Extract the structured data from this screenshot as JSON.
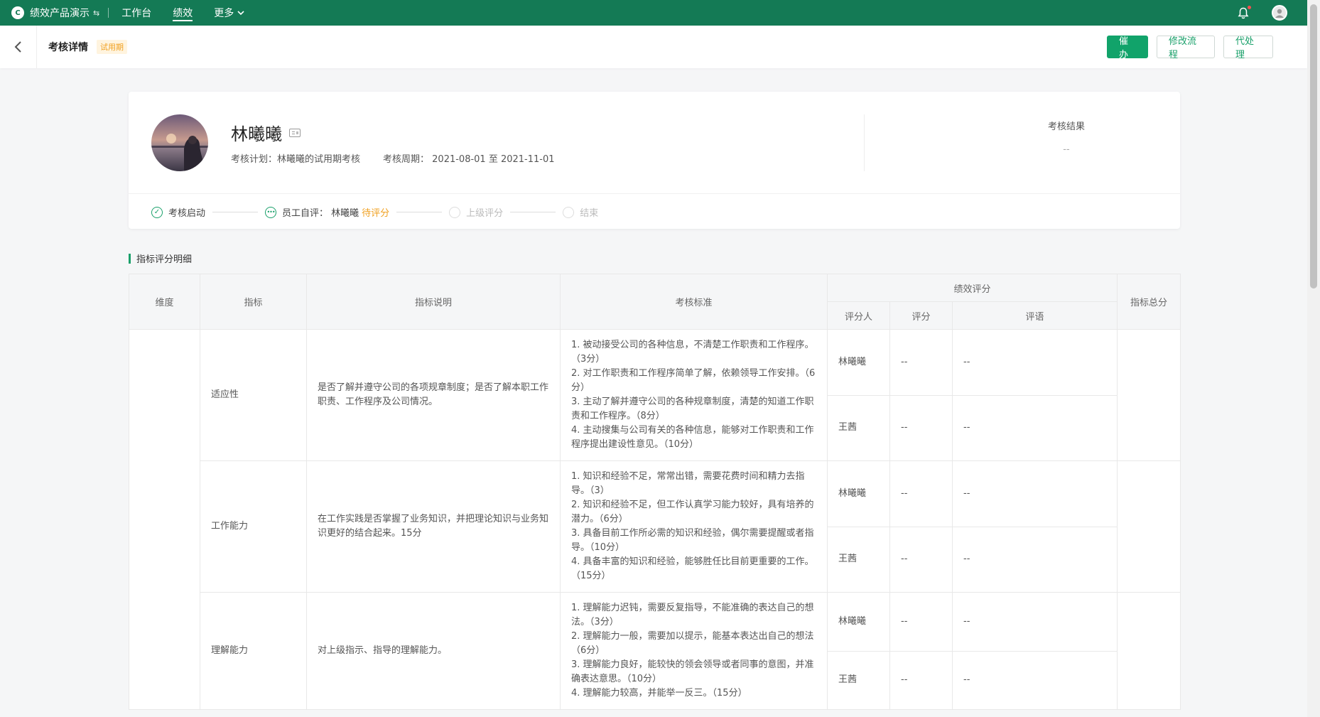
{
  "topnav": {
    "brand_logo": "C",
    "brand": "绩效产品演示",
    "items": [
      "工作台",
      "绩效",
      "更多"
    ]
  },
  "subheader": {
    "title": "考核详情",
    "tag": "试用期",
    "actions": {
      "urge": "催办",
      "modify": "修改流程",
      "proxy": "代处理"
    }
  },
  "profile": {
    "name": "林曦曦",
    "plan": "考核计划：林曦曦的试用期考核",
    "period": "考核周期：  2021-08-01 至 2021-11-01",
    "result_label": "考核结果",
    "result_value": "--"
  },
  "steps": [
    {
      "label": "考核启动"
    },
    {
      "label": "员工自评：  林曦曦",
      "status": "待评分"
    },
    {
      "label": "上级评分"
    },
    {
      "label": "结束"
    }
  ],
  "section": {
    "title": "指标评分明细"
  },
  "table": {
    "headers": {
      "dimension": "维度",
      "indicator": "指标",
      "desc": "指标说明",
      "standard": "考核标准",
      "score_group": "绩效评分",
      "rater": "评分人",
      "score": "评分",
      "comment": "评语",
      "total": "指标总分"
    },
    "rows": [
      {
        "indicator": "适应性",
        "desc": "是否了解并遵守公司的各项规章制度；是否了解本职工作职责、工作程序及公司情况。",
        "criteria": [
          "1. 被动接受公司的各种信息，不清楚工作职责和工作程序。（3分）",
          "2. 对工作职责和工作程序简单了解，依赖领导工作安排。（6分）",
          "3. 主动了解并遵守公司的各种规章制度，清楚的知道工作职责和工作程序。（8分）",
          "4. 主动搜集与公司有关的各种信息，能够对工作职责和工作程序提出建设性意见。（10分）"
        ],
        "raters": [
          {
            "name": "林曦曦",
            "score": "--",
            "comment": "--"
          },
          {
            "name": "王茜",
            "score": "--",
            "comment": "--"
          }
        ]
      },
      {
        "indicator": "工作能力",
        "desc": "在工作实践是否掌握了业务知识，并把理论知识与业务知识更好的结合起来。15分",
        "criteria": [
          "1. 知识和经验不足，常常出错，需要花费时间和精力去指导。（3）",
          "2. 知识和经验不足，但工作认真学习能力较好，具有培养的潜力。（6分）",
          "3. 具备目前工作所必需的知识和经验，偶尔需要提醒或者指导。（10分）",
          "4. 具备丰富的知识和经验，能够胜任比目前更重要的工作。（15分）"
        ],
        "raters": [
          {
            "name": "林曦曦",
            "score": "--",
            "comment": "--"
          },
          {
            "name": "王茜",
            "score": "--",
            "comment": "--"
          }
        ]
      },
      {
        "indicator": "理解能力",
        "desc": "对上级指示、指导的理解能力。",
        "criteria": [
          "1. 理解能力迟钝，需要反复指导，不能准确的表达自己的想法。（3分）",
          "2. 理解能力一般，需要加以提示，能基本表达出自己的想法（6分）",
          "3. 理解能力良好，能较快的领会领导或者同事的意图，并准确表达意思。（10分）",
          "4. 理解能力较高，并能举一反三。（15分）"
        ],
        "raters": [
          {
            "name": "林曦曦",
            "score": "--",
            "comment": "--"
          },
          {
            "name": "王茜",
            "score": "--",
            "comment": "--"
          }
        ]
      }
    ]
  }
}
